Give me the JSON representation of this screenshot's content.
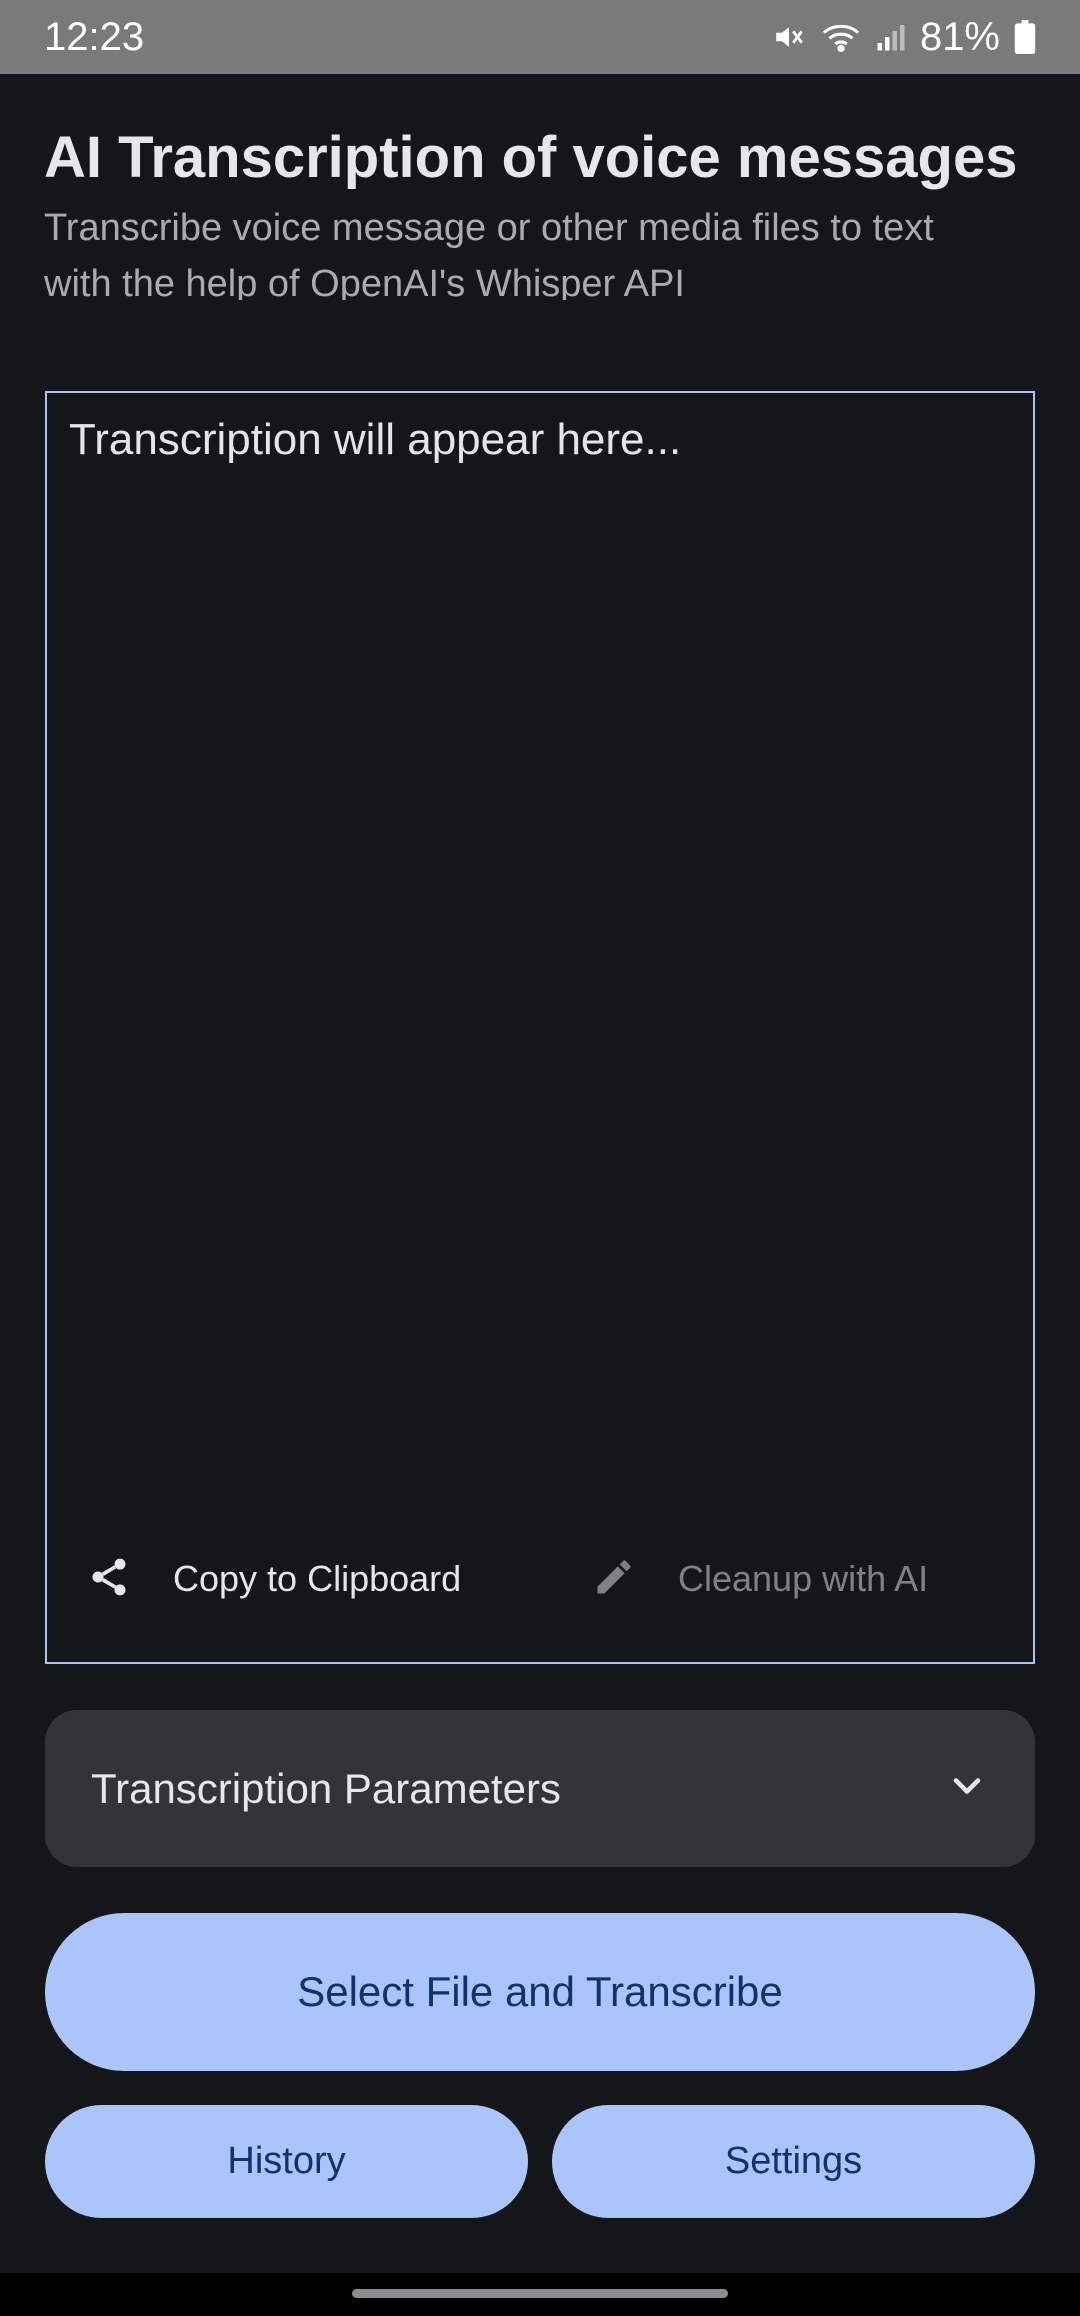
{
  "status_bar": {
    "time": "12:23",
    "battery": "81%",
    "icons": [
      "mute-icon",
      "wifi-icon",
      "signal-icon",
      "battery-icon"
    ]
  },
  "header": {
    "title": "AI Transcription of voice messages",
    "subtitle": "Transcribe voice message or other media files to text with the help of OpenAI's Whisper API"
  },
  "transcription": {
    "placeholder": "Transcription will appear here...",
    "copy_label": "Copy to Clipboard",
    "cleanup_label": "Cleanup with AI"
  },
  "parameters": {
    "label": "Transcription Parameters"
  },
  "buttons": {
    "primary": "Select File and Transcribe",
    "history": "History",
    "settings": "Settings"
  },
  "colors": {
    "background": "#15161a",
    "accent": "#abc5fb",
    "accent_text": "#12326b",
    "panel": "#323438",
    "border": "#aec4f5"
  }
}
